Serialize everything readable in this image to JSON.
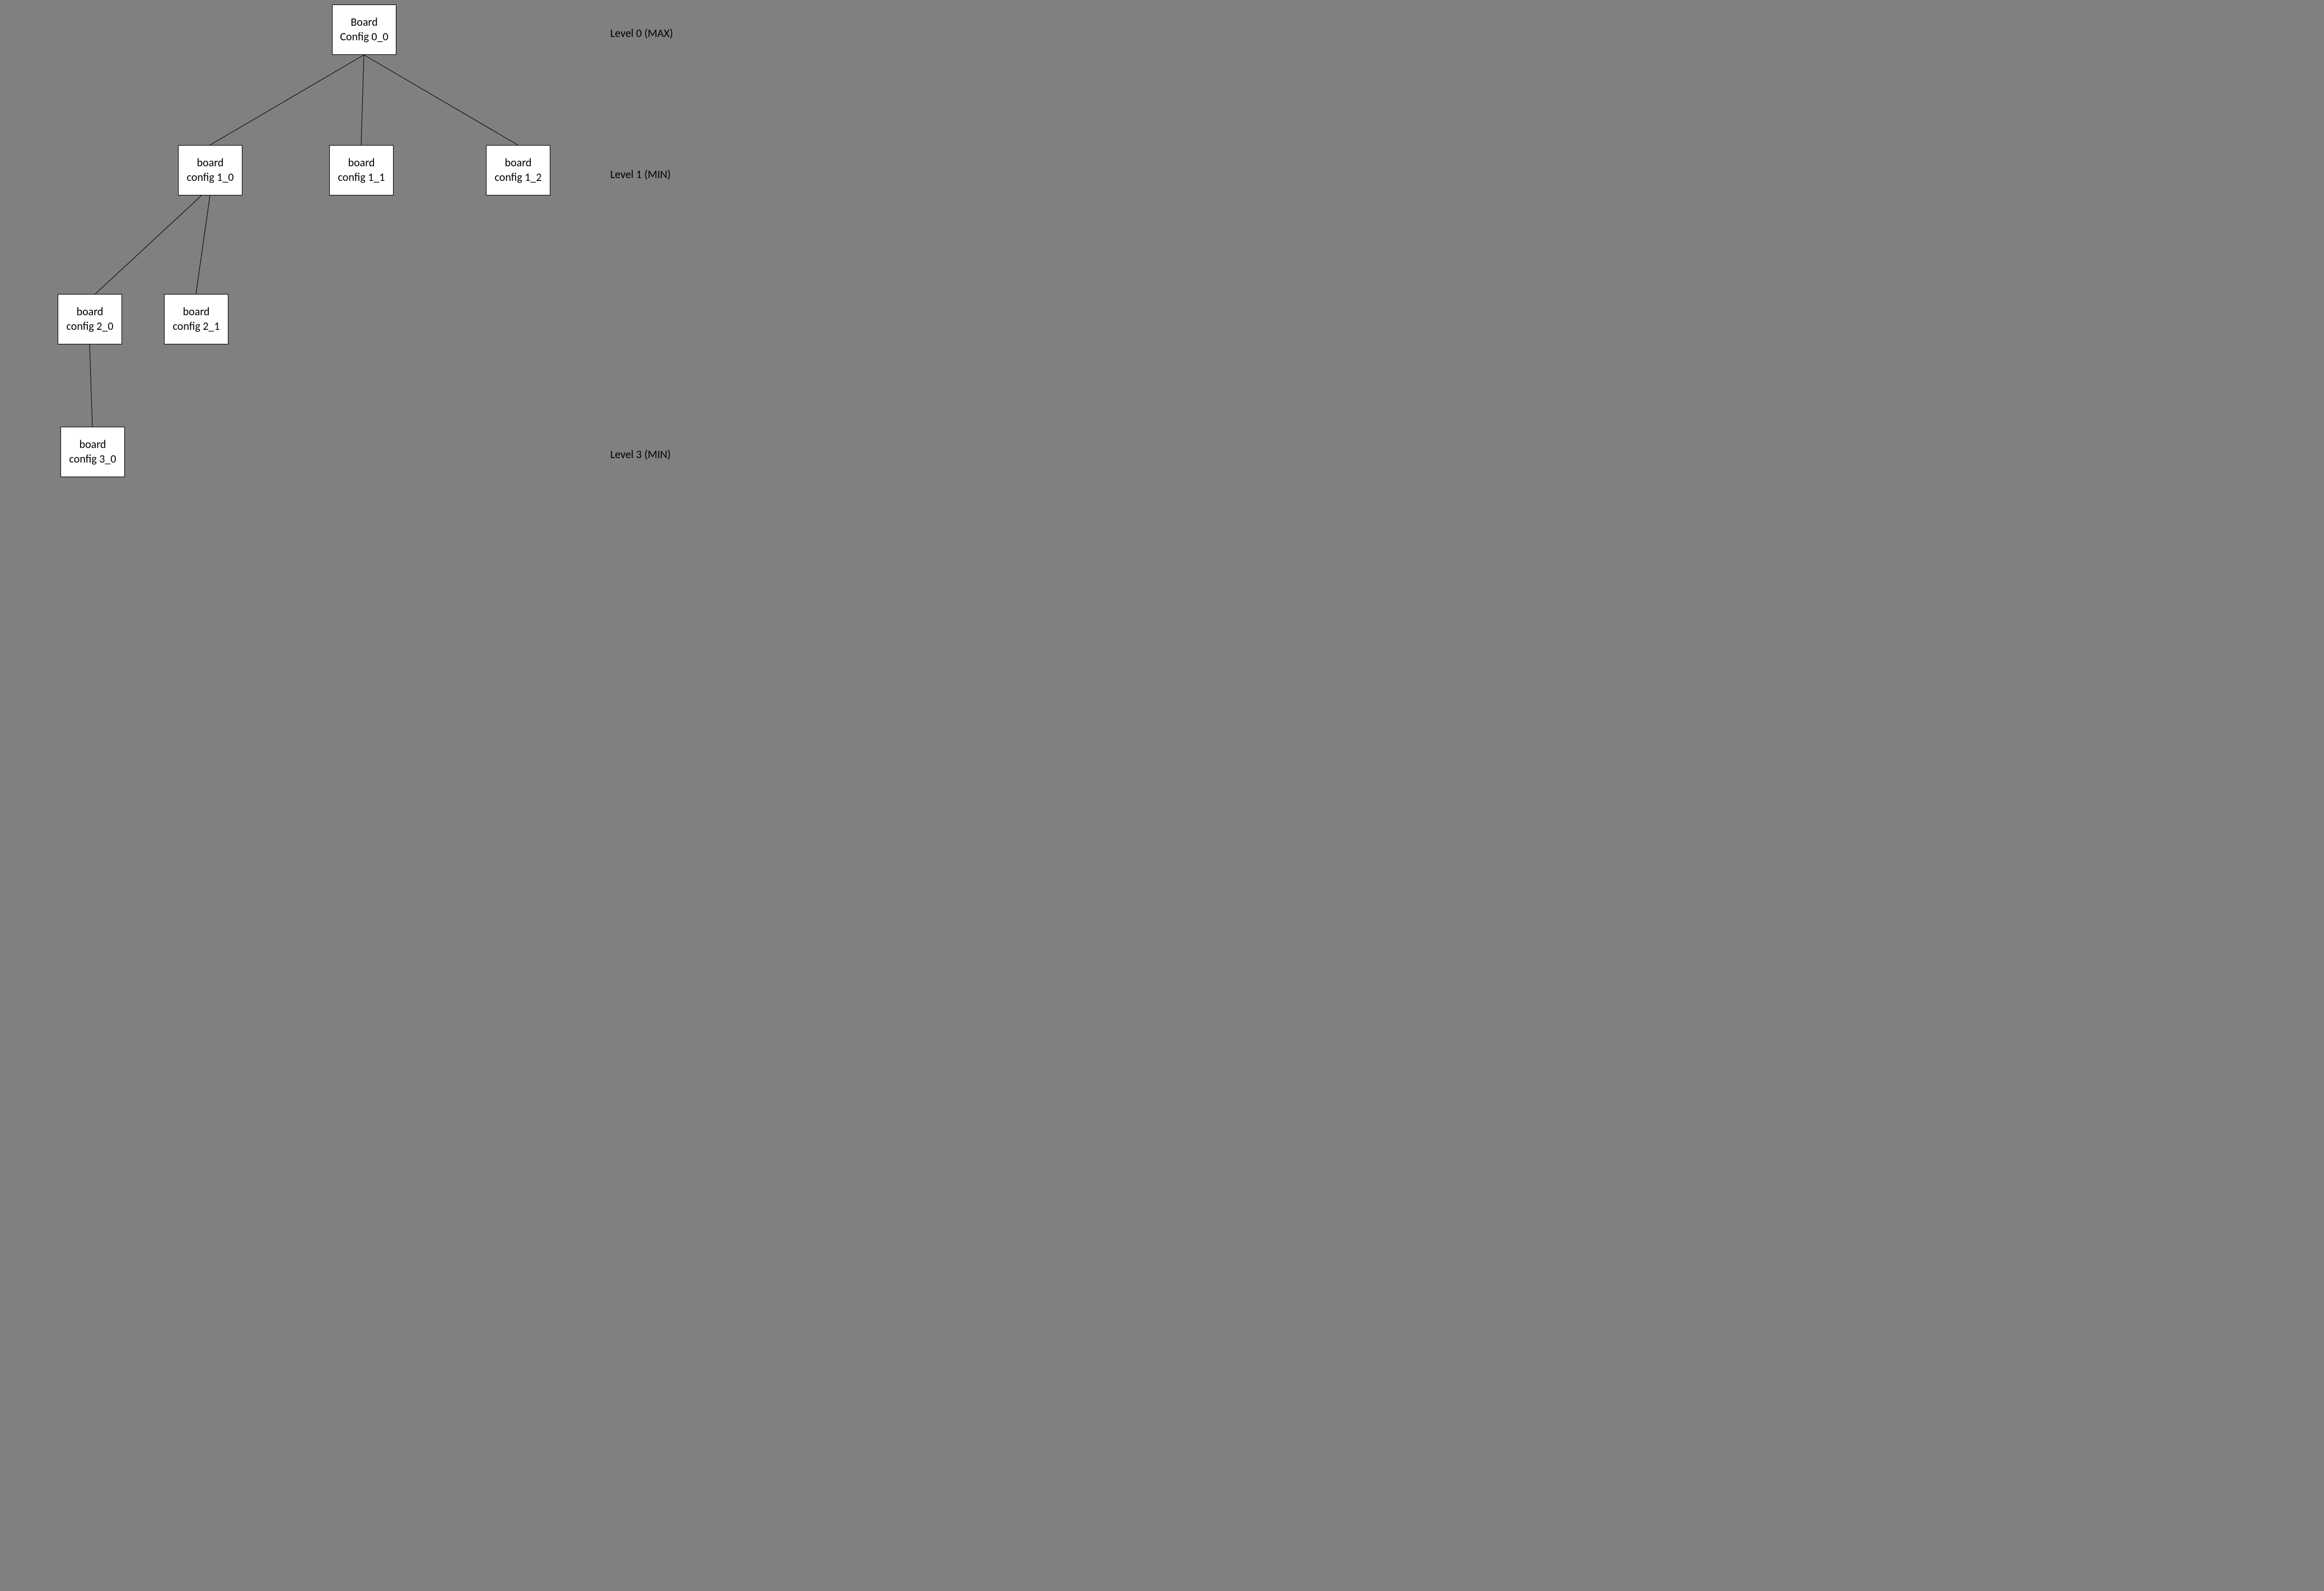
{
  "nodes": {
    "n00": {
      "line1": "Board",
      "line2": "Config 0_0"
    },
    "n10": {
      "line1": "board",
      "line2": "config 1_0"
    },
    "n11": {
      "line1": "board",
      "line2": "config 1_1"
    },
    "n12": {
      "line1": "board",
      "line2": "config 1_2"
    },
    "n20": {
      "line1": "board",
      "line2": "config 2_0"
    },
    "n21": {
      "line1": "board",
      "line2": "config 2_1"
    },
    "n30": {
      "line1": "board",
      "line2": "config 3_0"
    }
  },
  "levels": {
    "l0": "Level 0 (MAX)",
    "l1": "Level 1 (MIN)",
    "l3": "Level 3 (MIN)"
  },
  "colors": {
    "background": "#808080",
    "node_fill": "#ffffff",
    "stroke": "#000000"
  },
  "edges": [
    {
      "from": "n00",
      "to": "n10"
    },
    {
      "from": "n00",
      "to": "n11"
    },
    {
      "from": "n00",
      "to": "n12"
    },
    {
      "from": "n10",
      "to": "n20"
    },
    {
      "from": "n10",
      "to": "n21"
    },
    {
      "from": "n20",
      "to": "n30"
    }
  ]
}
